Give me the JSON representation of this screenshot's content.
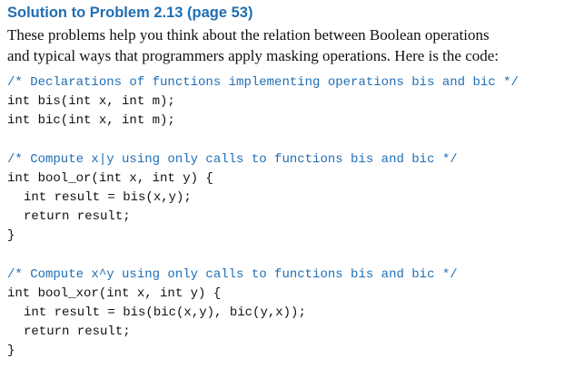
{
  "heading": "Solution to Problem 2.13 (page 53)",
  "paragraph": [
    "These problems help you think about the relation between Boolean operations",
    "and typical ways that programmers apply masking operations. Here is the code:"
  ],
  "code": {
    "block1": {
      "comment": "/* Declarations of functions implementing operations bis and bic */",
      "lines": [
        "int bis(int x, int m);",
        "int bic(int x, int m);"
      ]
    },
    "block2": {
      "comment": "/* Compute x|y using only calls to functions bis and bic */",
      "signature": "int bool_or(int x, int y) {",
      "body": [
        "int result = bis(x,y);",
        "return result;"
      ],
      "close": "}"
    },
    "block3": {
      "comment": "/* Compute x^y using only calls to functions bis and bic */",
      "signature": "int bool_xor(int x, int y) {",
      "body": [
        "int result = bis(bic(x,y), bic(y,x));",
        "return result;"
      ],
      "close": "}"
    }
  },
  "colors": {
    "accent": "#1f6eb5",
    "text": "#111111"
  }
}
